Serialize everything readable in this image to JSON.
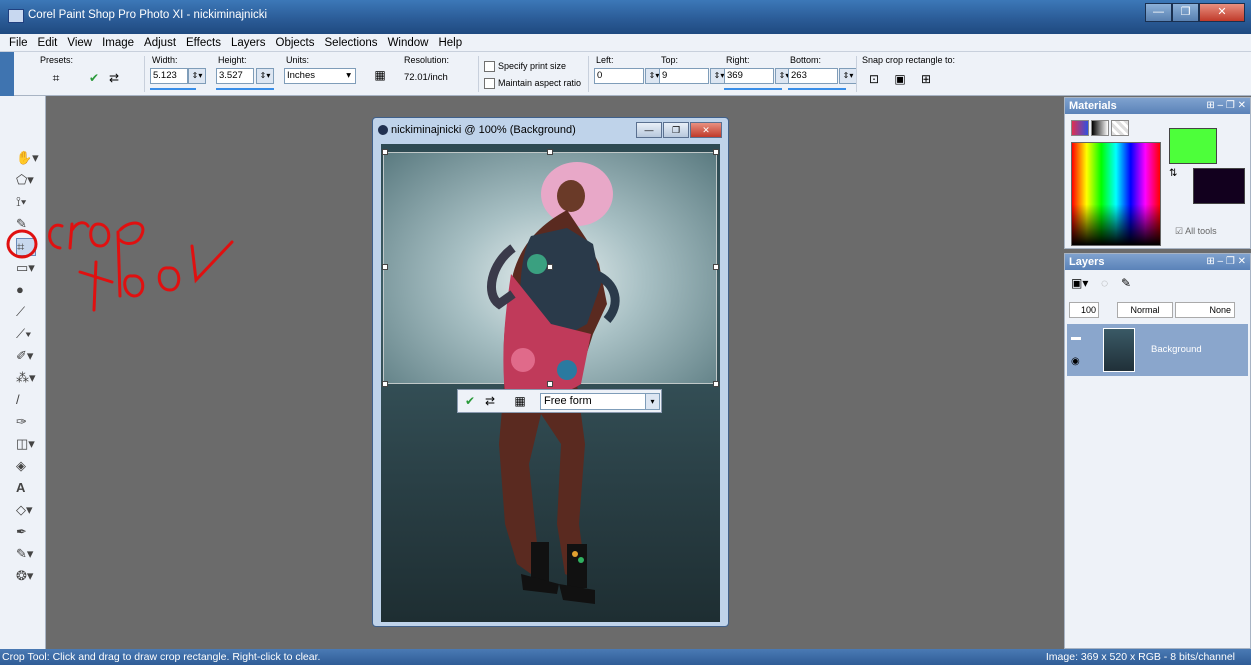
{
  "window": {
    "title": "Corel Paint Shop Pro Photo XI - nickiminajnicki"
  },
  "menu": [
    "File",
    "Edit",
    "View",
    "Image",
    "Adjust",
    "Effects",
    "Layers",
    "Objects",
    "Selections",
    "Window",
    "Help"
  ],
  "tool_options": {
    "presets_label": "Presets:",
    "width_label": "Width:",
    "width_value": "5.123",
    "height_label": "Height:",
    "height_value": "3.527",
    "units_label": "Units:",
    "units_value": "Inches",
    "resolution_label": "Resolution:",
    "resolution_value": "72.01/inch",
    "specify_print_size": "Specify print size",
    "maintain_aspect_ratio": "Maintain aspect ratio",
    "left_label": "Left:",
    "left_value": "0",
    "top_label": "Top:",
    "top_value": "9",
    "right_label": "Right:",
    "right_value": "369",
    "bottom_label": "Bottom:",
    "bottom_value": "263",
    "snap_label": "Snap crop rectangle to:"
  },
  "document": {
    "title": "nickiminajnicki @ 100% (Background)",
    "crop_mode": "Free form"
  },
  "annotation": {
    "text": "crop tool",
    "color": "#e01010"
  },
  "materials": {
    "title": "Materials",
    "all_tools": "All tools",
    "foreground": "#4dff3a",
    "background": "#12001e"
  },
  "layers": {
    "title": "Layers",
    "opacity": "100",
    "blend_mode": "Normal",
    "mask": "None",
    "layer_name": "Background"
  },
  "status": {
    "left": "Crop Tool: Click and drag to draw crop rectangle. Right-click to clear.",
    "right": "Image: 369 x 520 x RGB - 8 bits/channel"
  }
}
